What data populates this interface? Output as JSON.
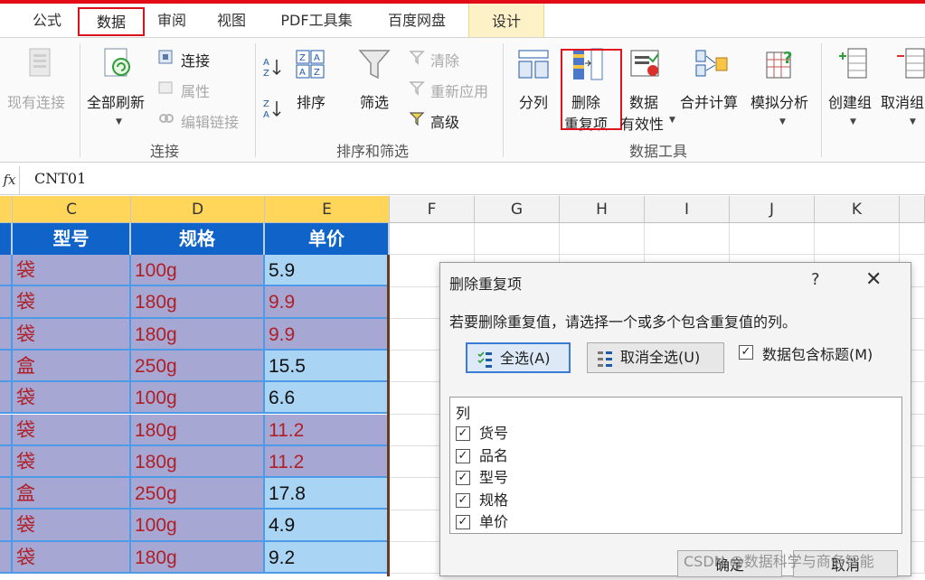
{
  "tabs": [
    {
      "label": "公式"
    },
    {
      "label": "数据"
    },
    {
      "label": "审阅"
    },
    {
      "label": "视图"
    },
    {
      "label": "PDF工具集"
    },
    {
      "label": "百度网盘"
    },
    {
      "label": "设计"
    }
  ],
  "ribbon": {
    "existing_conn": "现有连接",
    "refresh_all": "全部刷新",
    "connections": "连接",
    "properties": "属性",
    "edit_links": "编辑链接",
    "group_connections": "连接",
    "sort": "排序",
    "filter": "筛选",
    "clear": "清除",
    "reapply": "重新应用",
    "advanced": "高级",
    "group_sort_filter": "排序和筛选",
    "text_to_columns": "分列",
    "remove_dup_line1": "删除",
    "remove_dup_line2": "重复项",
    "validation_line1": "数据",
    "validation_line2": "有效性",
    "consolidate": "合并计算",
    "what_if": "模拟分析",
    "group_data_tools": "数据工具",
    "group": "创建组",
    "ungroup": "取消组"
  },
  "formula_bar": {
    "fx": "fx",
    "content": "CNT01"
  },
  "sheet": {
    "columns": [
      "C",
      "D",
      "E",
      "F",
      "G",
      "H",
      "I",
      "J",
      "K"
    ],
    "headers": [
      "型号",
      "规格",
      "单价"
    ],
    "rows": [
      [
        "袋",
        "100g",
        "5.9"
      ],
      [
        "袋",
        "180g",
        "9.9"
      ],
      [
        "袋",
        "180g",
        "9.9"
      ],
      [
        "盒",
        "250g",
        "15.5"
      ],
      [
        "袋",
        "100g",
        "6.6"
      ],
      [
        "袋",
        "180g",
        "11.2"
      ],
      [
        "袋",
        "180g",
        "11.2"
      ],
      [
        "盒",
        "250g",
        "17.8"
      ],
      [
        "袋",
        "100g",
        "4.9"
      ],
      [
        "袋",
        "180g",
        "9.2"
      ]
    ]
  },
  "dialog": {
    "title": "删除重复项",
    "help": "?",
    "close": "✕",
    "prompt": "若要删除重复值，请选择一个或多个包含重复值的列。",
    "select_all": "全选(A)",
    "unselect_all": "取消全选(U)",
    "has_headers": "数据包含标题(M)",
    "list_header": "列",
    "columns": [
      "货号",
      "品名",
      "型号",
      "规格",
      "单价"
    ],
    "ok": "确定",
    "cancel": "取消"
  },
  "watermark": "CSDN @数据科学与商务智能",
  "colors": {
    "accent_red": "#e0141d",
    "header_blue": "#0f63c9",
    "dup_purple": "#a6a8d3",
    "unique_blue": "#a9d4f4",
    "dup_text": "#b01f25",
    "col_selected": "#ffd55a"
  }
}
